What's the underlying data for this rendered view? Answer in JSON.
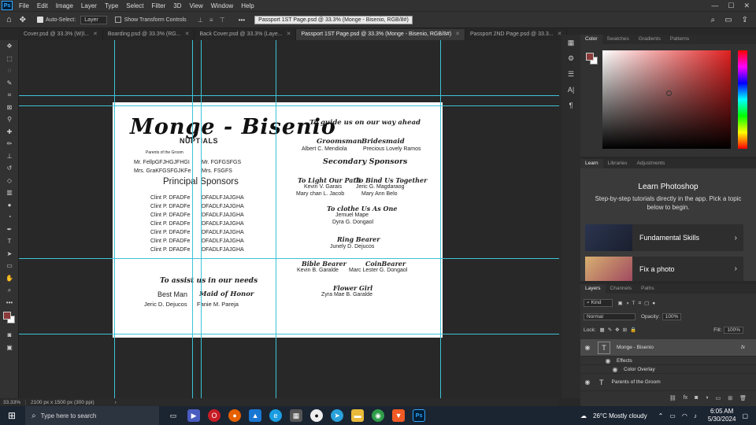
{
  "menubar": {
    "app_logo": "Ps",
    "items": [
      "File",
      "Edit",
      "Image",
      "Layer",
      "Type",
      "Select",
      "Filter",
      "3D",
      "View",
      "Window",
      "Help"
    ]
  },
  "options": {
    "auto_select_label": "Auto-Select:",
    "auto_select_value": "Layer",
    "transform_label": "Show Transform Controls",
    "more": "•••",
    "tooltip": "Passport 1ST Page.psd @ 33.3% (Monge - Bisenio, RGB/8#)"
  },
  "tabs": [
    {
      "label": "Cover.psd @ 33.3% (W)l..."
    },
    {
      "label": "Boarding.psd @ 33.3% (RG..."
    },
    {
      "label": "Back Cover.psd @ 33.3% (Laye..."
    },
    {
      "label": "Passport 1ST Page.psd @ 33.3% (Monge - Bisenio, RGB/8#)"
    },
    {
      "label": "Passport 2ND Page.psd @ 33.3..."
    }
  ],
  "doc": {
    "title": "Monge - Bisenio",
    "nuptials": "NUPTIALS",
    "parents_label": "Parents of the Groom",
    "parents": [
      {
        "left": "Mr. FellpGFJHGJFHGI",
        "right": "Mr. FGFGSFGS"
      },
      {
        "left": "Mrs. GraKFGSFGJKFe",
        "right": "Mrs. FSGFS"
      }
    ],
    "principal_title": "Principal Sponsors",
    "principal_rows": [
      {
        "left": "Clint P. DFADFe",
        "right": "DFADLFJAJGHA"
      },
      {
        "left": "Clint P. DFADFe",
        "right": "DFADLFJAJGHA"
      },
      {
        "left": "Clint P. DFADFe",
        "right": "DFADLFJAJGHA"
      },
      {
        "left": "Clint P. DFADFe",
        "right": "DFADLFJAJGHA"
      },
      {
        "left": "Clint P. DFADFe",
        "right": "DFADLFJAJGHA"
      },
      {
        "left": "Clint P. DFADFe",
        "right": "DFADLFJAJGHA"
      },
      {
        "left": "Clint P. DFADFe",
        "right": "DFADLFJAJGHA"
      }
    ],
    "assist_title": "To assist us in our needs",
    "best_man_label": "Best Man",
    "maid_label": "Maid of Honor",
    "best_man": "Jeric D. Dejucos",
    "maid": "Fanie M. Pareja",
    "guide_title": "To guide us on our way ahead",
    "groomsman_label": "Groomsman",
    "bridesmaid_label": "Bridesmaid",
    "groomsman": "Albert C. Mendiola",
    "bridesmaid": "Precious Lovely Ramos",
    "secondary_title": "Secondary Sponsors",
    "light_label": "To Light Our Path",
    "bind_label": "To Bind Us Together",
    "light_names": [
      "Kevin V. Garais",
      "Mary chan L. Jacob"
    ],
    "bind_names": [
      "Jeric G. Magdaraog",
      "Mary Ann Belo"
    ],
    "clothe_label": "To clothe Us As One",
    "clothe_names": [
      "Jemuel Mape",
      "Dyra G. Dongaol"
    ],
    "ring_label": "Ring Bearer",
    "ring_name": "Junely D. Dejucos",
    "bible_label": "Bible Bearer",
    "coin_label": "CoinBearer",
    "bible_name": "Kevin B. Garalde",
    "coin_name": "Marc Lester G. Dongaol",
    "flower_label": "Flower Girl",
    "flower_name": "Zyra Mae B. Garalde"
  },
  "status": {
    "zoom": "33.33%",
    "size": "2100 px x 1500 px (300 ppi)"
  },
  "color_tabs": [
    "Color",
    "Swatches",
    "Gradients",
    "Patterns"
  ],
  "learn_tabs": [
    "Learn",
    "Libraries",
    "Adjustments"
  ],
  "learn": {
    "title": "Learn Photoshop",
    "desc": "Step-by-step tutorials directly in the app. Pick a topic below to begin.",
    "cards": [
      "Fundamental Skills",
      "Fix a photo"
    ]
  },
  "layers_tabs": [
    "Layers",
    "Channels",
    "Paths"
  ],
  "layers": {
    "kind": "Kind",
    "blend": "Normal",
    "opacity_label": "Opacity:",
    "opacity": "100%",
    "lock_label": "Lock:",
    "fill_label": "Fill:",
    "fill": "100%",
    "rows": [
      "Monge - Bisenio",
      "Effects",
      "Color Overlay",
      "Parents of the Groom"
    ],
    "fx": "fx"
  },
  "taskbar": {
    "search": "Type here to search",
    "weather": "26°C  Mostly cloudy",
    "time": "6:05 AM",
    "date": "5/30/2024"
  },
  "colors": {
    "accent": "#3ec2d6",
    "fg_swatch": "#8b3a3a",
    "ps_blue": "#31a8ff"
  }
}
